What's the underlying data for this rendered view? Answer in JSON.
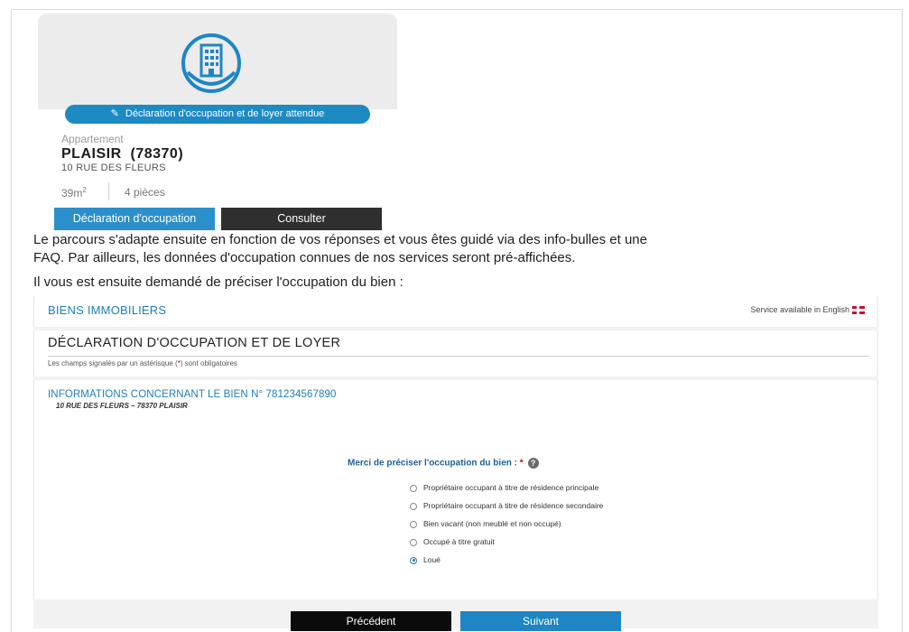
{
  "card": {
    "declaration_badge": "Déclaration d'occupation et de loyer attendue",
    "property_type": "Appartement",
    "city": "PLAISIR  (78370)",
    "address": "10 RUE DES FLEURS",
    "surface": "39m",
    "surface_sup": "2",
    "rooms": "4 pièces",
    "declare_button": "Déclaration d'occupation",
    "consult_button": "Consulter"
  },
  "text": {
    "paragraph1_line1": "Le parcours s'adapte ensuite en fonction de vos réponses et vous êtes guidé via des info-bulles et une",
    "paragraph1_line2": "FAQ. Par ailleurs, les données d'occupation connues de nos services seront pré-affichées.",
    "paragraph2": "Il vous est ensuite demandé de préciser l'occupation du bien :"
  },
  "form": {
    "section_title": "BIENS IMMOBILIERS",
    "service_english": "Service available in English",
    "declaration_title": "DÉCLARATION D'OCCUPATION ET DE LOYER",
    "mandatory_before": "Les champs signalés par un astérisque (",
    "mandatory_star": "*",
    "mandatory_after": ") sont obligatoires",
    "info_title": "INFORMATIONS CONCERNANT LE BIEN N° ",
    "info_number": "781234567890",
    "info_address": "10 RUE DES FLEURS – 78370 PLAISIR",
    "question": "Merci de préciser l'occupation du bien : ",
    "question_required": "*",
    "help_symbol": "?",
    "options": [
      "Propriétaire occupant à titre de résidence principale",
      "Propriétaire occupant à titre de résidence secondaire",
      "Bien vacant (non meublé et non occupé)",
      "Occupé à titre gratuit",
      "Loué"
    ],
    "selected_option": "Loué",
    "prev_button": "Précédent",
    "next_button": "Suivant"
  },
  "colors": {
    "accent_blue": "#1e86c4",
    "dark_button": "#0b0b0b",
    "required_red": "#cc0000"
  },
  "icons": {
    "building": "building-icon",
    "pencil": "pencil-icon",
    "help": "help-icon",
    "flag": "uk-flag-icon"
  }
}
